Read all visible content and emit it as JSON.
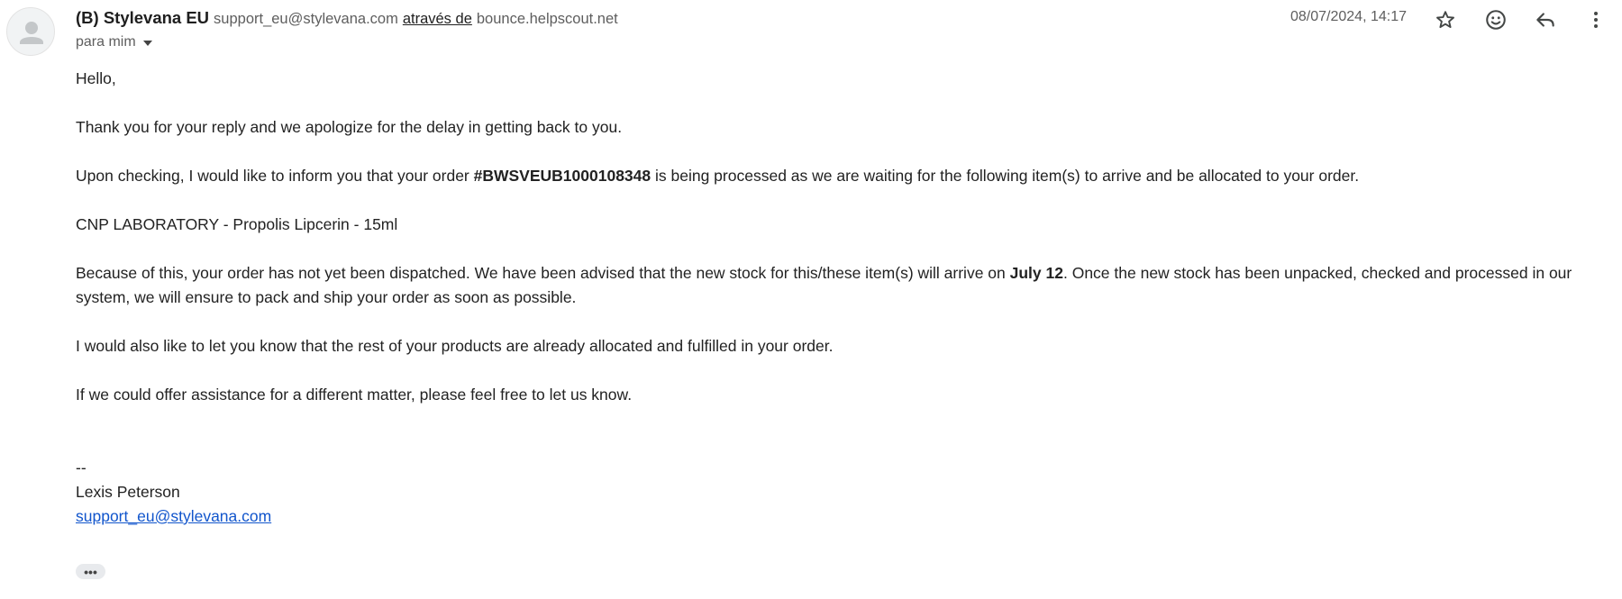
{
  "header": {
    "sender_name": "(B) Stylevana EU",
    "sender_email": "support_eu@stylevana.com",
    "via_label": "através de",
    "via_domain": "bounce.helpscout.net",
    "to_label": "para mim",
    "date": "08/07/2024, 14:17",
    "icons": [
      "star-icon",
      "emoji-icon",
      "reply-icon",
      "more-vert-icon"
    ]
  },
  "message": {
    "greeting": "Hello,",
    "para1": "Thank you for your reply and we apologize for the delay in getting back to you.",
    "para2_before": "Upon checking, I would like to inform you that your order ",
    "order_number": "#BWSVEUB1000108348",
    "para2_after": " is being processed as we are waiting for the following item(s) to arrive and be allocated to your order.",
    "item": "CNP LABORATORY - Propolis Lipcerin - 15ml",
    "para3_before": "Because of this, your order has not yet been dispatched. We have been advised that the new stock for this/these item(s) will arrive on ",
    "arrival_date": "July 12",
    "para3_after": ". Once the new stock has been unpacked, checked and processed in our system, we will ensure to pack and ship your order as soon as possible.",
    "para4": "I would also like to let you know that the rest of your products are already allocated and fulfilled in your order.",
    "para5": "If we could offer assistance for a different matter, please feel free to let us know.",
    "sig_dashes": "--",
    "sig_name": "Lexis Peterson",
    "sig_email": "support_eu@stylevana.com"
  },
  "more_label": "•••",
  "colors": {
    "link": "#1155cc",
    "text": "#222222",
    "muted": "#5e5e5e"
  }
}
